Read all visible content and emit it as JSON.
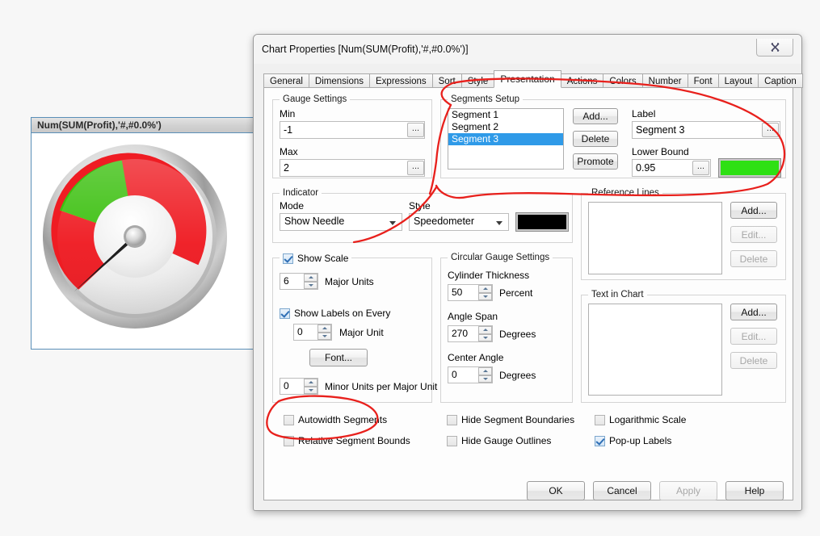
{
  "gauge_object": {
    "caption": "Num(SUM(Profit),'#,#0.0%')",
    "segments": [
      {
        "name": "Segment 1",
        "color": "#ef1c23"
      },
      {
        "name": "Segment 2",
        "color": "#f3e420"
      },
      {
        "name": "Segment 3",
        "color": "#3cc010"
      }
    ],
    "needle_color": "#111111"
  },
  "dialog": {
    "title": "Chart Properties [Num(SUM(Profit),'#,#0.0%')]",
    "close_icon": "close-icon",
    "close_glyph": "✖"
  },
  "tabs": [
    {
      "label": "General",
      "active": false
    },
    {
      "label": "Dimensions",
      "active": false
    },
    {
      "label": "Expressions",
      "active": false
    },
    {
      "label": "Sort",
      "active": false
    },
    {
      "label": "Style",
      "active": false
    },
    {
      "label": "Presentation",
      "active": true
    },
    {
      "label": "Actions",
      "active": false
    },
    {
      "label": "Colors",
      "active": false
    },
    {
      "label": "Number",
      "active": false
    },
    {
      "label": "Font",
      "active": false
    },
    {
      "label": "Layout",
      "active": false
    },
    {
      "label": "Caption",
      "active": false
    }
  ],
  "gauge_settings": {
    "group_title": "Gauge Settings",
    "min_label": "Min",
    "min_value": "-1",
    "max_label": "Max",
    "max_value": "2",
    "ellipsis_label": "..."
  },
  "segments_setup": {
    "group_title": "Segments Setup",
    "items": [
      "Segment 1",
      "Segment 2",
      "Segment 3"
    ],
    "selected_index": 2,
    "add_label": "Add...",
    "delete_label": "Delete",
    "promote_label": "Promote",
    "label_caption": "Label",
    "label_value": "Segment 3",
    "lower_bound_caption": "Lower Bound",
    "lower_bound_value": "0.95",
    "segment_color": "#2ee014",
    "ellipsis_label": "..."
  },
  "indicator": {
    "group_title": "Indicator",
    "mode_label": "Mode",
    "mode_value": "Show Needle",
    "style_label": "Style",
    "style_value": "Speedometer",
    "color": "#000000"
  },
  "scale": {
    "show_scale_label": "Show Scale",
    "show_scale_checked": true,
    "major_units_value": "6",
    "major_units_label": "Major Units",
    "show_labels_label": "Show Labels on Every",
    "show_labels_checked": true,
    "major_unit_value": "0",
    "major_unit_label": "Major Unit",
    "font_button": "Font...",
    "minor_units_value": "0",
    "minor_units_label": "Minor Units per Major Unit"
  },
  "circular_gauge": {
    "group_title": "Circular Gauge Settings",
    "cylinder_thickness_label": "Cylinder Thickness",
    "cylinder_thickness_value": "50",
    "cylinder_thickness_unit": "Percent",
    "angle_span_label": "Angle Span",
    "angle_span_value": "270",
    "angle_span_unit": "Degrees",
    "center_angle_label": "Center Angle",
    "center_angle_value": "0",
    "center_angle_unit": "Degrees"
  },
  "reference_lines": {
    "group_title": "Reference Lines",
    "items": [],
    "add_label": "Add...",
    "edit_label": "Edit...",
    "delete_label": "Delete",
    "edit_disabled": true,
    "delete_disabled": true
  },
  "text_in_chart": {
    "group_title": "Text in Chart",
    "items": [],
    "add_label": "Add...",
    "edit_label": "Edit...",
    "delete_label": "Delete",
    "edit_disabled": true,
    "delete_disabled": true
  },
  "checkboxes": [
    {
      "label": "Autowidth Segments",
      "checked": false,
      "name": "autowidth-segments"
    },
    {
      "label": "Relative Segment Bounds",
      "checked": false,
      "name": "relative-segment-bounds"
    },
    {
      "label": "Hide Segment Boundaries",
      "checked": false,
      "name": "hide-segment-boundaries"
    },
    {
      "label": "Hide Gauge Outlines",
      "checked": false,
      "name": "hide-gauge-outlines"
    },
    {
      "label": "Logarithmic Scale",
      "checked": false,
      "name": "logarithmic-scale"
    },
    {
      "label": "Pop-up Labels",
      "checked": true,
      "name": "popup-labels"
    }
  ],
  "dialog_buttons": {
    "ok": "OK",
    "cancel": "Cancel",
    "apply": "Apply",
    "apply_disabled": true,
    "help": "Help"
  },
  "annotation_color": "#e8201c"
}
